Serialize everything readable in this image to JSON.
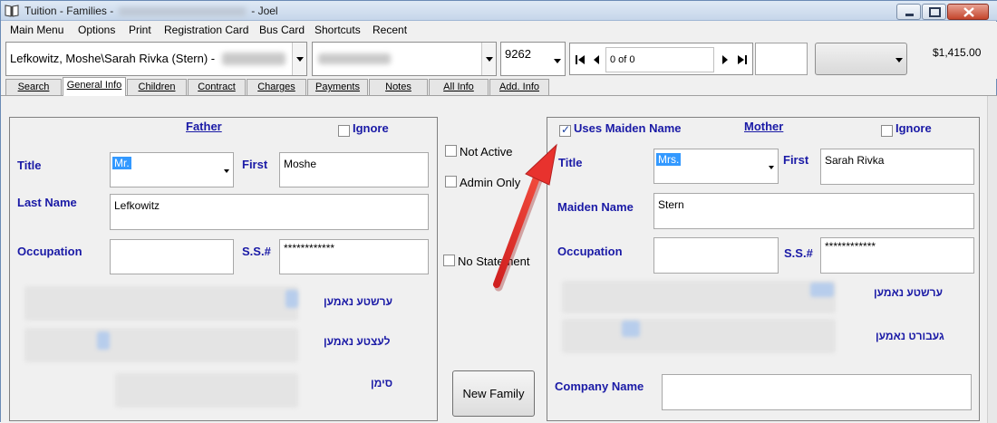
{
  "window": {
    "title_prefix": "Tuition - Families -",
    "title_suffix": "- Joel"
  },
  "menu": [
    "Main Menu",
    "Options",
    "Print",
    "Registration Card",
    "Bus Card",
    "Shortcuts",
    "Recent"
  ],
  "toolbar": {
    "family_combo": "Lefkowitz, Moshe\\Sarah Rivka (Stern) -",
    "id_combo": "9262",
    "nav_position": "0 of 0",
    "balance": "$1,415.00"
  },
  "tabs": [
    "Search",
    "General Info",
    "Children",
    "Contract",
    "Charges",
    "Payments",
    "Notes",
    "All Info",
    "Add. Info"
  ],
  "active_tab": "General Info",
  "father": {
    "heading": "Father",
    "ignore_label": "Ignore",
    "title_label": "Title",
    "title_value": "Mr.",
    "first_label": "First",
    "first_value": "Moshe",
    "last_label": "Last Name",
    "last_value": "Lefkowitz",
    "occupation_label": "Occupation",
    "occupation_value": "",
    "ss_label": "S.S.#",
    "ss_value": "************",
    "heb_label_1": "ערשטע נאמען",
    "heb_label_2": "לעצטע נאמען",
    "heb_label_3": "סימן"
  },
  "middle": {
    "not_active_label": "Not Active",
    "admin_only_label": "Admin Only",
    "no_statement_label": "No Statement",
    "new_family_button": "New Family"
  },
  "mother": {
    "uses_maiden_label": "Uses Maiden Name",
    "uses_maiden_checked": true,
    "heading": "Mother",
    "ignore_label": "Ignore",
    "title_label": "Title",
    "title_value": "Mrs.",
    "first_label": "First",
    "first_value": "Sarah Rivka",
    "maiden_label": "Maiden Name",
    "maiden_value": "Stern",
    "occupation_label": "Occupation",
    "occupation_value": "",
    "ss_label": "S.S.#",
    "ss_value": "************",
    "heb_label_1": "ערשטע נאמען",
    "heb_label_2": "געבורט נאמען",
    "company_label": "Company Name",
    "company_value": ""
  },
  "colors": {
    "label_blue": "#1a1aa6",
    "selection_blue": "#3399ff",
    "annotation_arrow": "#e8322e"
  }
}
